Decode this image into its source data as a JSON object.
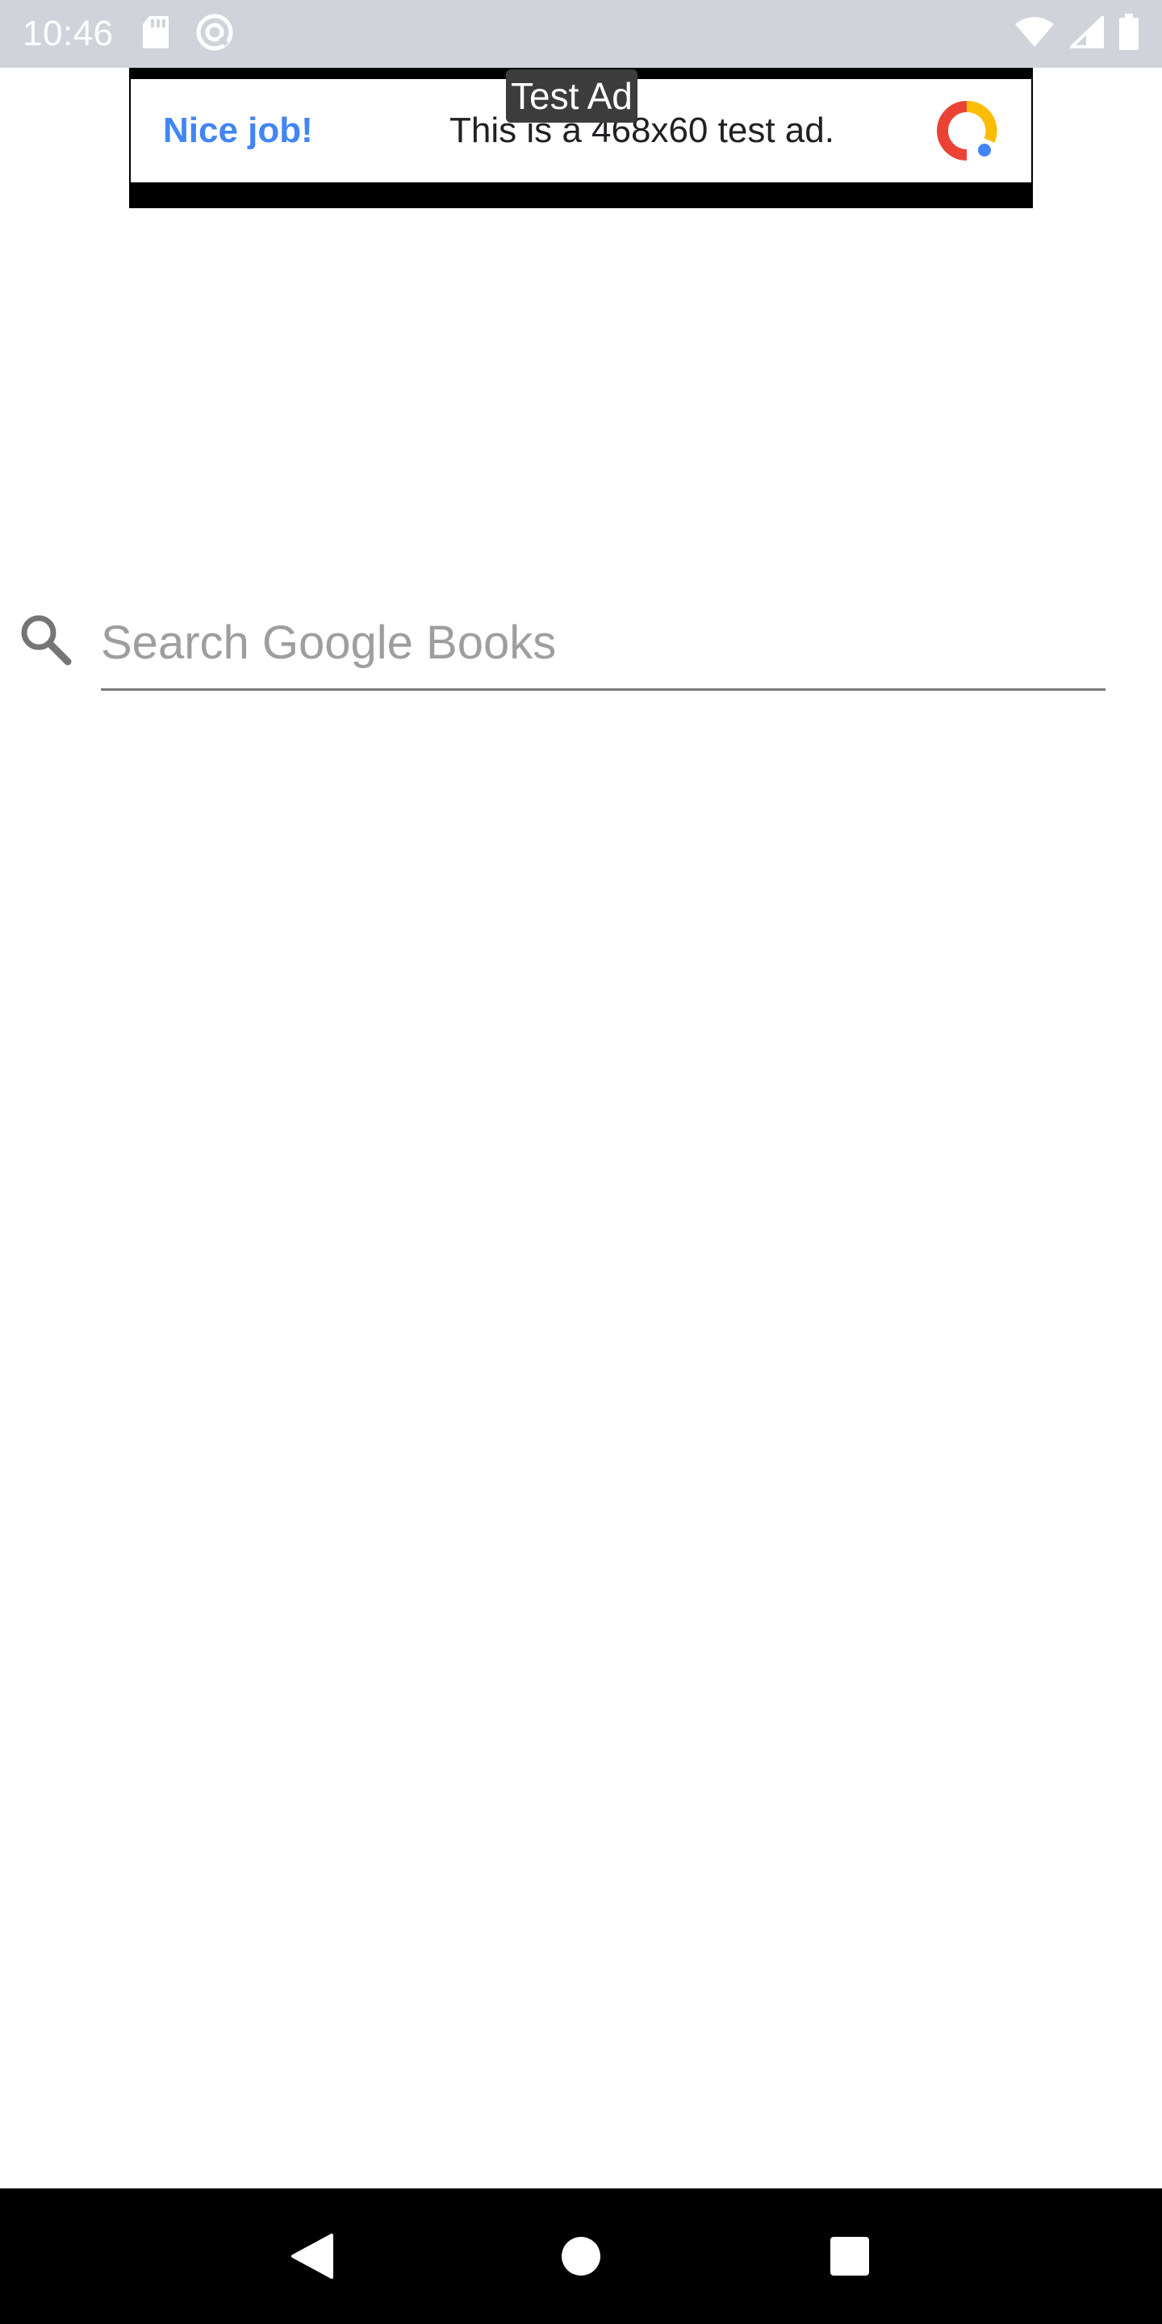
{
  "status_bar": {
    "time": "10:46",
    "icons": [
      "sd-card-icon",
      "data-saver-icon",
      "wifi-icon",
      "signal-icon",
      "battery-icon"
    ]
  },
  "ad": {
    "badge": "Test Ad",
    "cta": "Nice job!",
    "text": "This is a 468x60 test ad.",
    "logo": "google-ads-logo-icon"
  },
  "search": {
    "placeholder": "Search Google Books",
    "value": ""
  },
  "nav_bar": {
    "buttons": [
      "back-icon",
      "home-icon",
      "recents-icon"
    ]
  },
  "colors": {
    "status_bar_bg": "#d0d4da",
    "ad_cta": "#4285f4",
    "nav_bar_bg": "#000000"
  }
}
